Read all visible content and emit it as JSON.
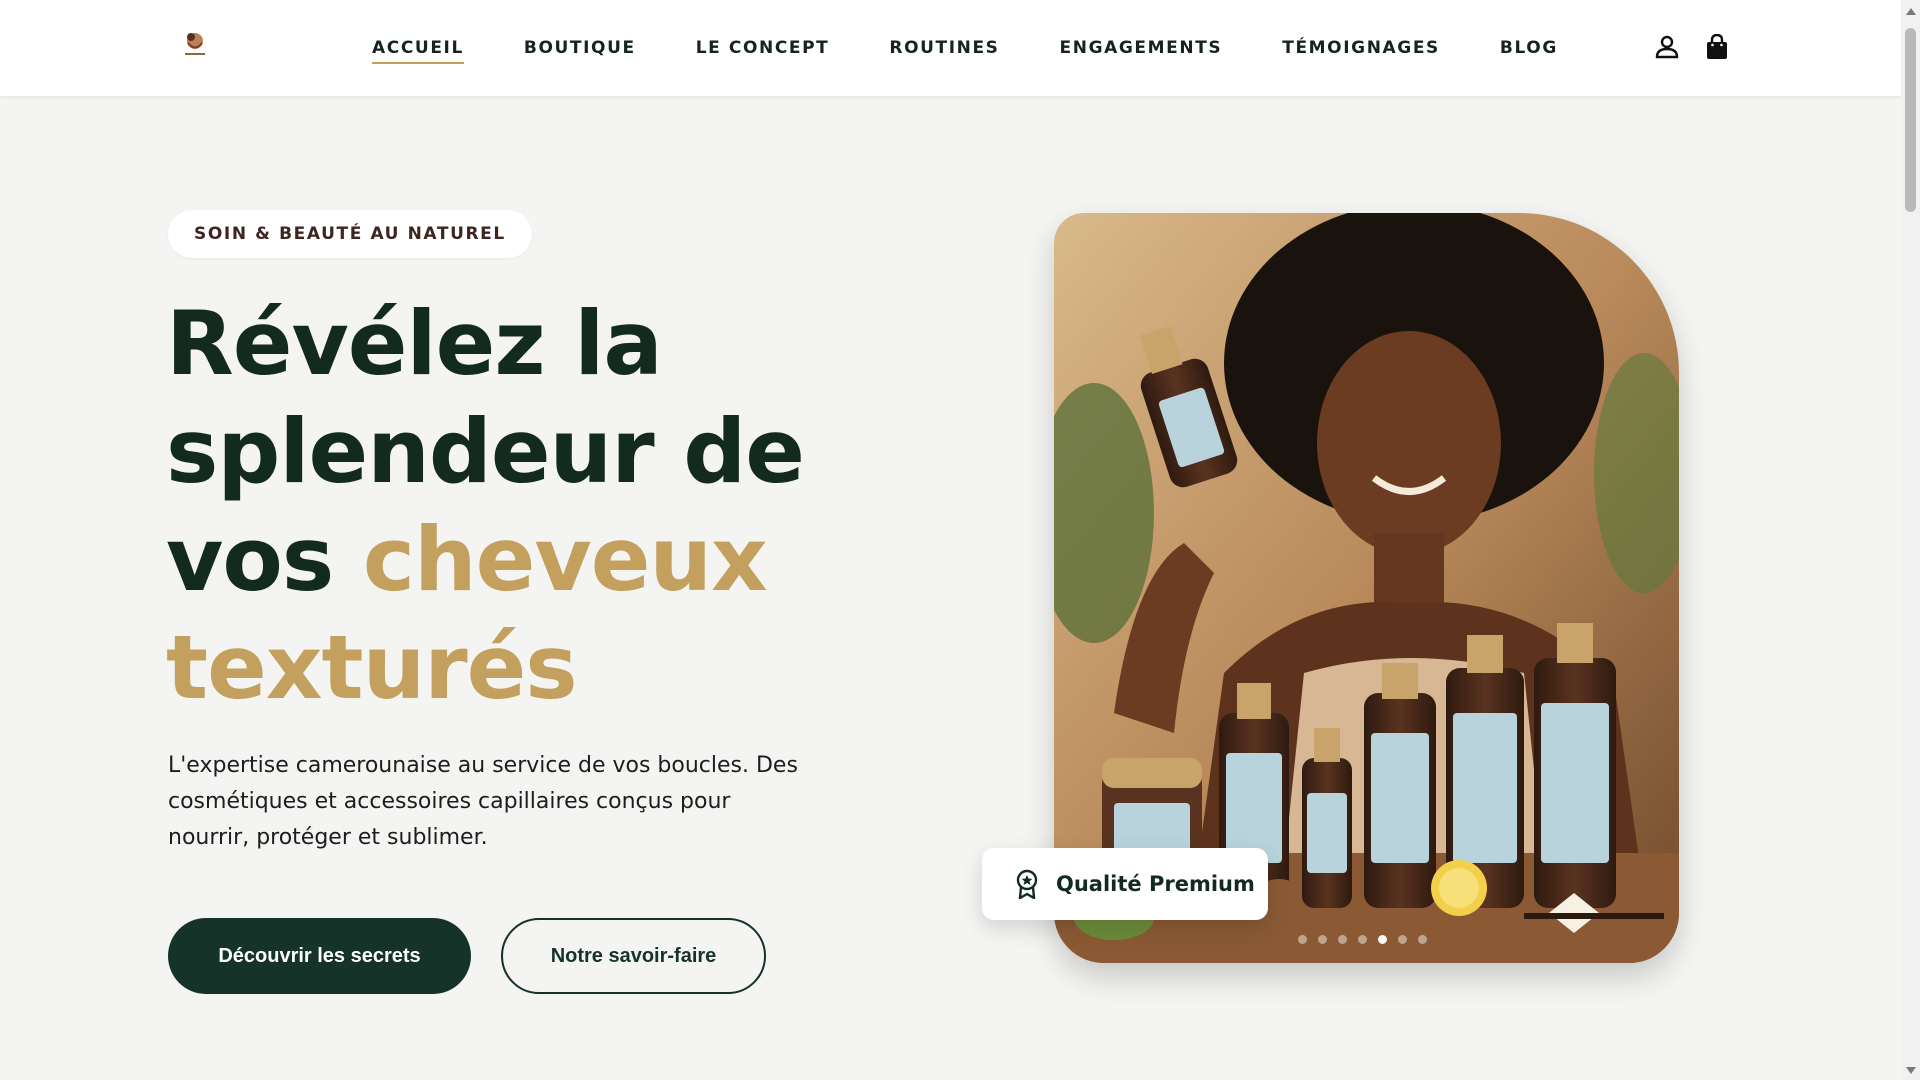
{
  "brand": {
    "logo_icon": "brand-logo-icon"
  },
  "nav": {
    "items": [
      {
        "label": "ACCUEIL",
        "active": true
      },
      {
        "label": "BOUTIQUE",
        "active": false
      },
      {
        "label": "LE CONCEPT",
        "active": false
      },
      {
        "label": "ROUTINES",
        "active": false
      },
      {
        "label": "ENGAGEMENTS",
        "active": false
      },
      {
        "label": "TÉMOIGNAGES",
        "active": false
      },
      {
        "label": "BLOG",
        "active": false
      }
    ],
    "account_icon": "user-icon",
    "cart_icon": "shopping-bag-icon"
  },
  "hero": {
    "badge": "SOIN & BEAUTÉ AU NATUREL",
    "title_line1": "Révélez la",
    "title_line2": "splendeur de",
    "title_line3_plain": "vos",
    "title_line3_accent": "cheveux",
    "title_line4_accent": "texturés",
    "description": "L'expertise camerounaise au service de vos boucles. Des cosmétiques et accessoires capillaires conçus pour nourrir, protéger et sublimer.",
    "primary_button": "Découvrir les secrets",
    "secondary_button": "Notre savoir-faire",
    "quality_badge": "Qualité Premium",
    "quality_icon": "award-ribbon-icon",
    "carousel": {
      "slide_count": 7,
      "active_index": 4
    }
  },
  "colors": {
    "accent": "#c4a05e",
    "dark_green": "#163329",
    "background": "#f4f4f2"
  }
}
